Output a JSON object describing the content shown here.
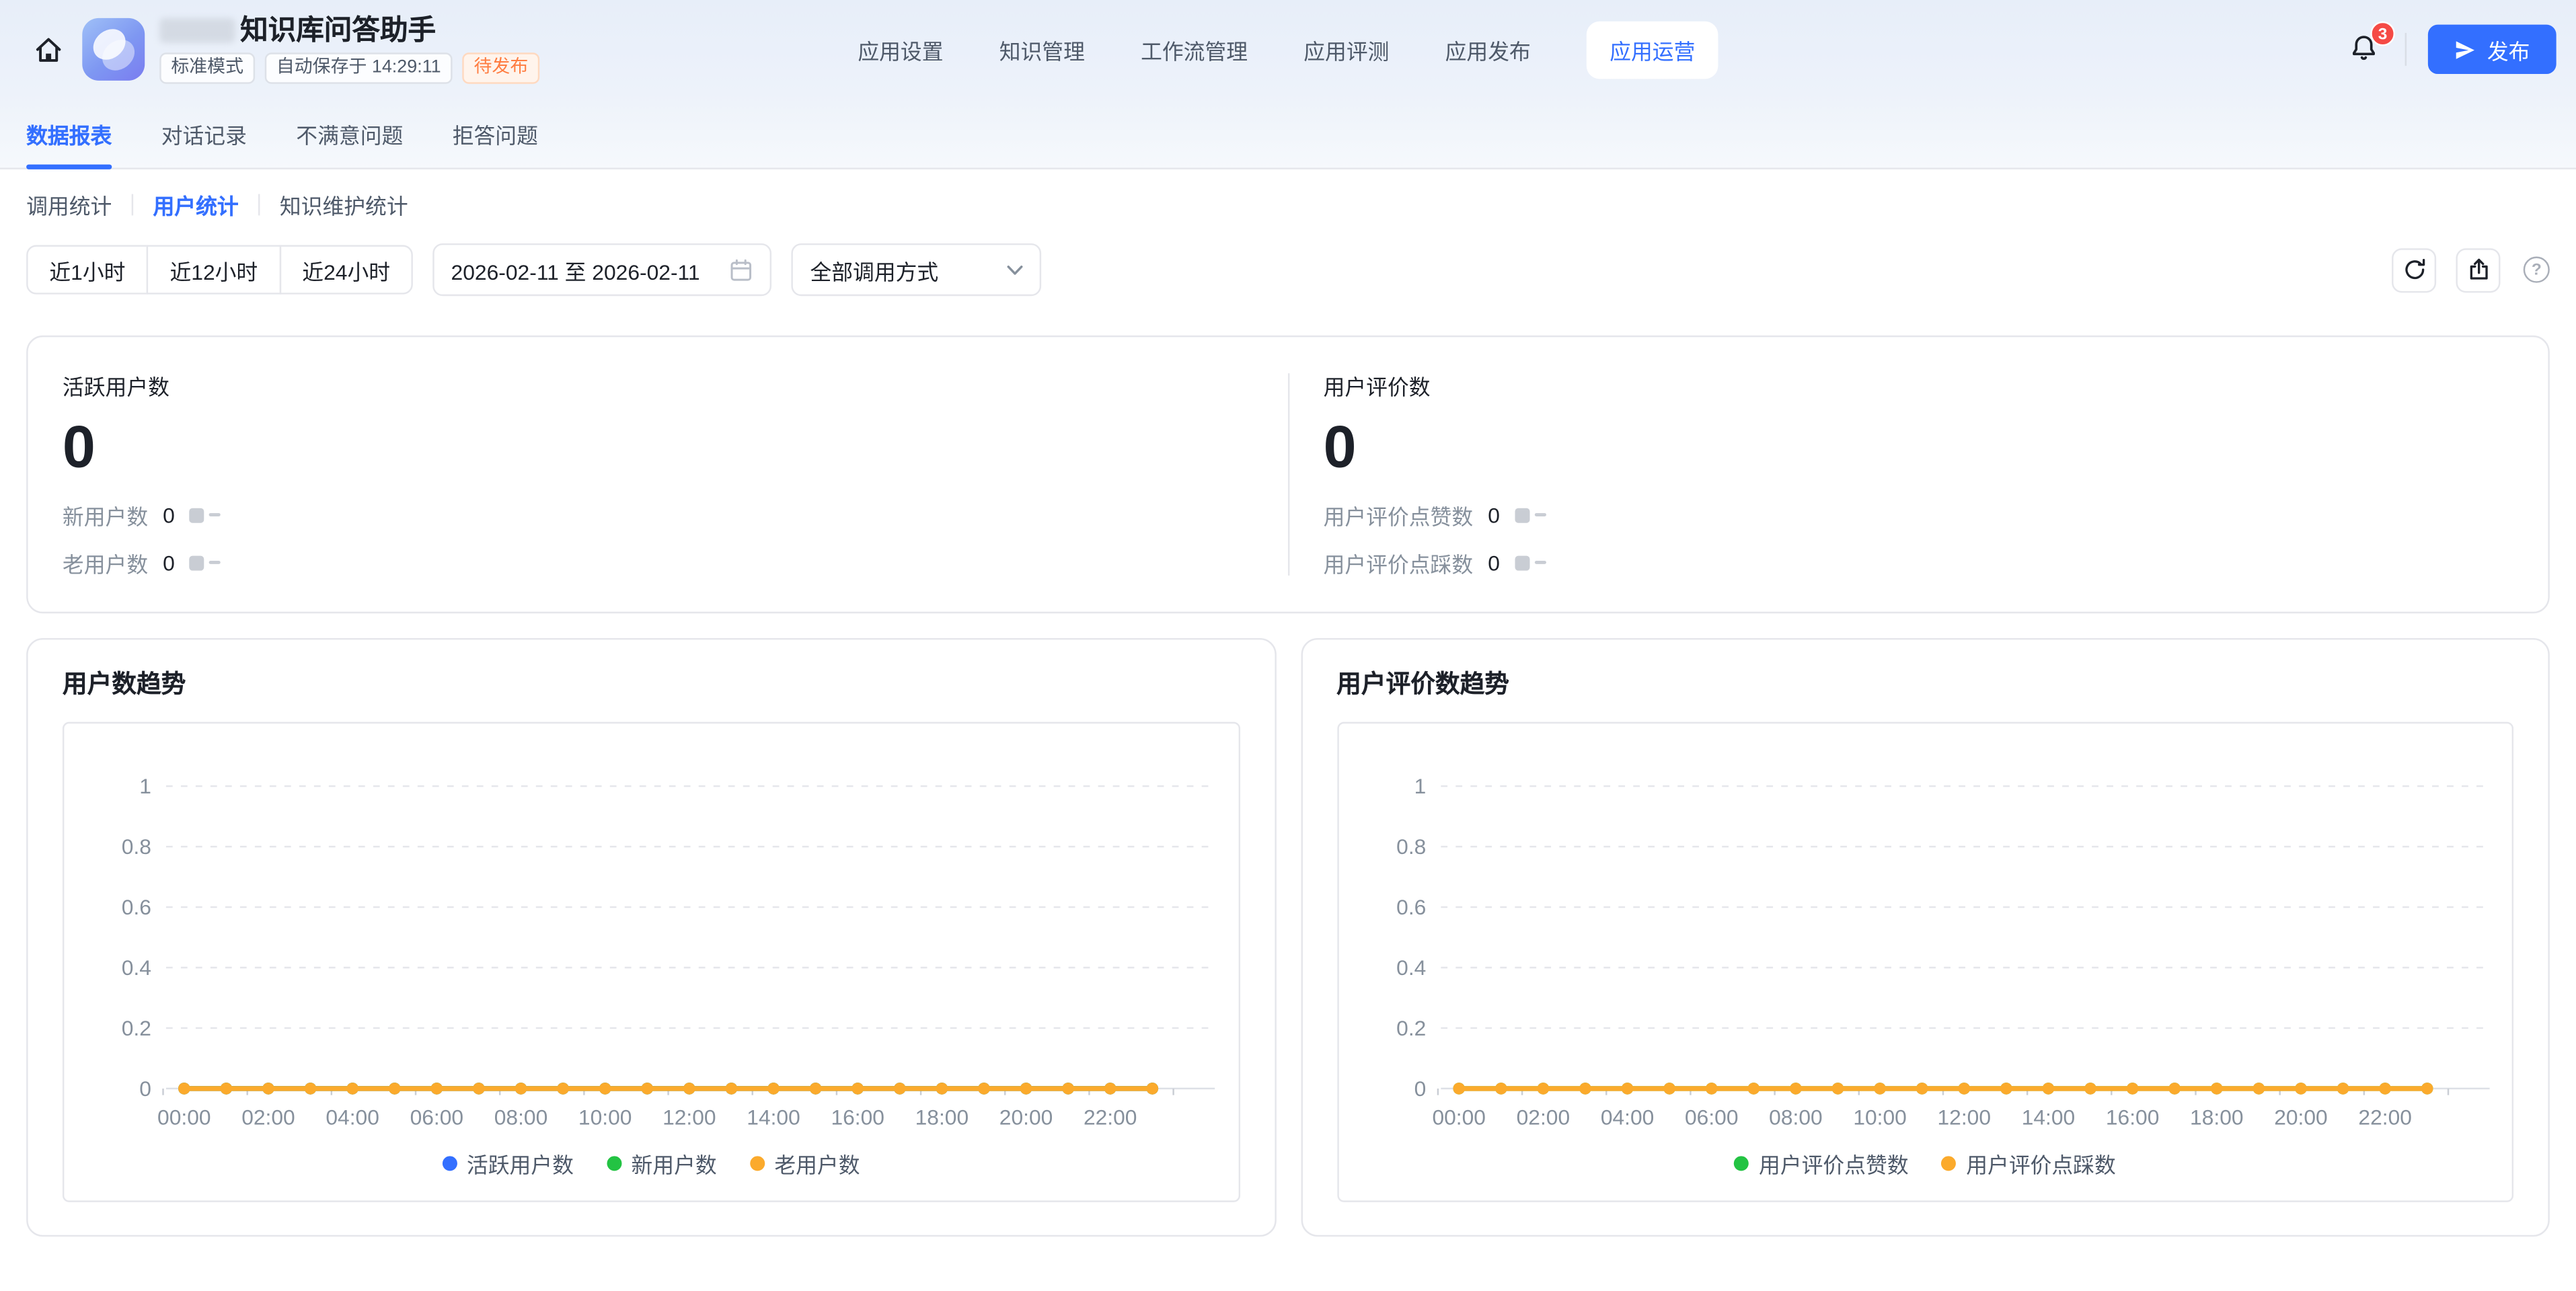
{
  "colors": {
    "accent_blue": "#336fff",
    "orange": "#fbaa2c",
    "green": "#23c343",
    "badge_red": "#f54a45",
    "status_orange": "#ff7d41"
  },
  "header": {
    "app_title": "知识库问答助手",
    "mode_badge": "标准模式",
    "autosave_text": "自动保存于 14:29:11",
    "status_badge": "待发布",
    "nav": [
      {
        "label": "应用设置"
      },
      {
        "label": "知识管理"
      },
      {
        "label": "工作流管理"
      },
      {
        "label": "应用评测"
      },
      {
        "label": "应用发布"
      },
      {
        "label": "应用运营",
        "active": true
      }
    ],
    "notification_count": "3",
    "publish_label": "发布"
  },
  "tabs": [
    {
      "label": "数据报表",
      "active": true
    },
    {
      "label": "对话记录"
    },
    {
      "label": "不满意问题"
    },
    {
      "label": "拒答问题"
    }
  ],
  "subtabs": [
    {
      "label": "调用统计"
    },
    {
      "label": "用户统计",
      "active": true
    },
    {
      "label": "知识维护统计"
    }
  ],
  "filters": {
    "time_ranges": [
      "近1小时",
      "近12小时",
      "近24小时"
    ],
    "date_range": "2026-02-11 至 2026-02-11",
    "call_type": "全部调用方式",
    "help_glyph": "?"
  },
  "stats": {
    "left": {
      "title": "活跃用户数",
      "value": "0",
      "rows": [
        {
          "label": "新用户数",
          "value": "0"
        },
        {
          "label": "老用户数",
          "value": "0"
        }
      ]
    },
    "right": {
      "title": "用户评价数",
      "value": "0",
      "rows": [
        {
          "label": "用户评价点赞数",
          "value": "0"
        },
        {
          "label": "用户评价点踩数",
          "value": "0"
        }
      ]
    }
  },
  "chart_data": [
    {
      "type": "line",
      "title": "用户数趋势",
      "x": [
        "00:00",
        "01:00",
        "02:00",
        "03:00",
        "04:00",
        "05:00",
        "06:00",
        "07:00",
        "08:00",
        "09:00",
        "10:00",
        "11:00",
        "12:00",
        "13:00",
        "14:00",
        "15:00",
        "16:00",
        "17:00",
        "18:00",
        "19:00",
        "20:00",
        "21:00",
        "22:00",
        "23:00"
      ],
      "x_label_every": 2,
      "series": [
        {
          "name": "活跃用户数",
          "color": "#336fff",
          "values": [
            0,
            0,
            0,
            0,
            0,
            0,
            0,
            0,
            0,
            0,
            0,
            0,
            0,
            0,
            0,
            0,
            0,
            0,
            0,
            0,
            0,
            0,
            0,
            0
          ]
        },
        {
          "name": "新用户数",
          "color": "#23c343",
          "values": [
            0,
            0,
            0,
            0,
            0,
            0,
            0,
            0,
            0,
            0,
            0,
            0,
            0,
            0,
            0,
            0,
            0,
            0,
            0,
            0,
            0,
            0,
            0,
            0
          ]
        },
        {
          "name": "老用户数",
          "color": "#fbaa2c",
          "values": [
            0,
            0,
            0,
            0,
            0,
            0,
            0,
            0,
            0,
            0,
            0,
            0,
            0,
            0,
            0,
            0,
            0,
            0,
            0,
            0,
            0,
            0,
            0,
            0
          ]
        }
      ],
      "ylim": [
        0,
        1
      ],
      "yticks": [
        0,
        0.2,
        0.4,
        0.6,
        0.8,
        1
      ],
      "grid": "dashed-horizontal",
      "legend_position": "bottom"
    },
    {
      "type": "line",
      "title": "用户评价数趋势",
      "x": [
        "00:00",
        "01:00",
        "02:00",
        "03:00",
        "04:00",
        "05:00",
        "06:00",
        "07:00",
        "08:00",
        "09:00",
        "10:00",
        "11:00",
        "12:00",
        "13:00",
        "14:00",
        "15:00",
        "16:00",
        "17:00",
        "18:00",
        "19:00",
        "20:00",
        "21:00",
        "22:00",
        "23:00"
      ],
      "x_label_every": 2,
      "series": [
        {
          "name": "用户评价点赞数",
          "color": "#23c343",
          "values": [
            0,
            0,
            0,
            0,
            0,
            0,
            0,
            0,
            0,
            0,
            0,
            0,
            0,
            0,
            0,
            0,
            0,
            0,
            0,
            0,
            0,
            0,
            0,
            0
          ]
        },
        {
          "name": "用户评价点踩数",
          "color": "#fbaa2c",
          "values": [
            0,
            0,
            0,
            0,
            0,
            0,
            0,
            0,
            0,
            0,
            0,
            0,
            0,
            0,
            0,
            0,
            0,
            0,
            0,
            0,
            0,
            0,
            0,
            0
          ]
        }
      ],
      "ylim": [
        0,
        1
      ],
      "yticks": [
        0,
        0.2,
        0.4,
        0.6,
        0.8,
        1
      ],
      "grid": "dashed-horizontal",
      "legend_position": "bottom"
    }
  ]
}
